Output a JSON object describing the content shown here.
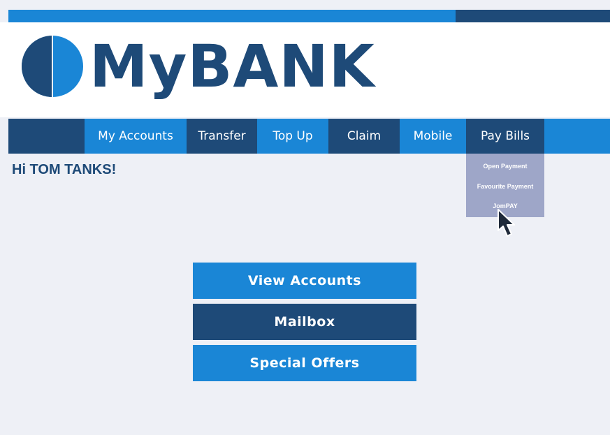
{
  "brand": {
    "name": "MyBANK",
    "logo_icon": "half-circle-logo-icon",
    "colors": {
      "primary_light": "#1a86d6",
      "primary_dark": "#1e4a78",
      "dropdown_bg": "#9ea6c8"
    }
  },
  "nav": {
    "items": [
      {
        "label": "My Accounts"
      },
      {
        "label": "Transfer"
      },
      {
        "label": "Top Up"
      },
      {
        "label": "Claim"
      },
      {
        "label": "Mobile"
      },
      {
        "label": "Pay Bills"
      }
    ]
  },
  "greeting": "Hi TOM TANKS!",
  "pay_bills_menu": {
    "items": [
      {
        "label": "Open Payment"
      },
      {
        "label": "Favourite Payment"
      },
      {
        "label": "JomPAY"
      }
    ]
  },
  "actions": [
    {
      "label": "View Accounts"
    },
    {
      "label": "Mailbox"
    },
    {
      "label": "Special Offers"
    }
  ],
  "cursor_icon": "mouse-pointer-icon"
}
